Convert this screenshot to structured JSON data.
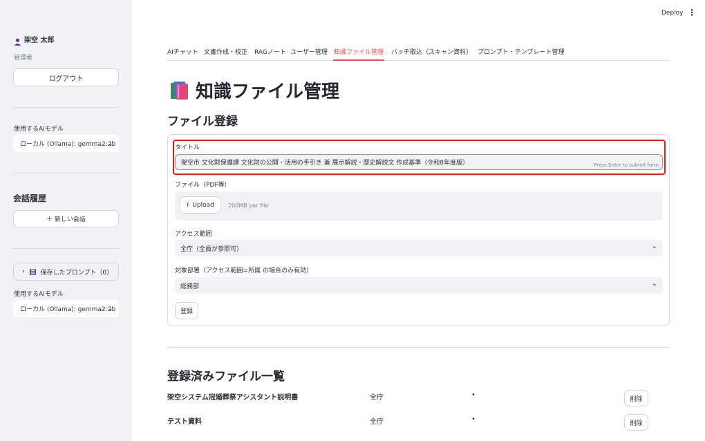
{
  "sidebar": {
    "user_name": "架空 太郎",
    "user_role": "管理者",
    "logout_label": "ログアウト",
    "model_label_1": "使用するAIモデル",
    "model_value_1": "ローカル (Ollama): gemma2:2b",
    "history_title": "会話履歴",
    "new_chat_label": "＋ 新しい会話",
    "saved_prompts_label": "保存したプロンプト（0）",
    "model_label_2": "使用するAIモデル",
    "model_value_2": "ローカル (Ollama): gemma2:2b"
  },
  "header": {
    "deploy_label": "Deploy"
  },
  "tabs": [
    {
      "label": "AIチャット"
    },
    {
      "label": "文書作成・校正"
    },
    {
      "label": "RAGノート"
    },
    {
      "label": "ユーザー管理"
    },
    {
      "label": "知識ファイル管理"
    },
    {
      "label": "バッチ取込（スキャン資料）"
    },
    {
      "label": "プロンプト・テンプレート管理"
    }
  ],
  "active_tab_index": 4,
  "page": {
    "title": "知識ファイル管理",
    "register_section": "ファイル登録",
    "form": {
      "title_label": "タイトル",
      "title_value": "架空市 文化財保護課 文化財の公開・活用の手引き 兼 展示解説・歴史解説文 作成基準（令和8年度版）",
      "enter_hint": "Press Enter to submit form",
      "file_label": "ファイル（PDF等）",
      "upload_label": "Upload",
      "upload_limit": "200MB per file",
      "access_label": "アクセス範囲",
      "access_value": "全庁（全員が参照可）",
      "dept_label": "対象部署（アクセス範囲=所属 の場合のみ有効）",
      "dept_value": "総務部",
      "submit_label": "登録"
    },
    "list_section": "登録済みファイル一覧",
    "files": [
      {
        "name": "架空システム冠婚葬祭アシスタント説明書",
        "scope": "全庁",
        "bullet": "•",
        "delete_label": "削除"
      },
      {
        "name": "テスト資料",
        "scope": "全庁",
        "bullet": "•",
        "delete_label": "削除"
      }
    ]
  },
  "colors": {
    "accent": "#ff4b4b",
    "highlight": "#e41b1b",
    "sidebar_bg": "#f0f2f6"
  }
}
